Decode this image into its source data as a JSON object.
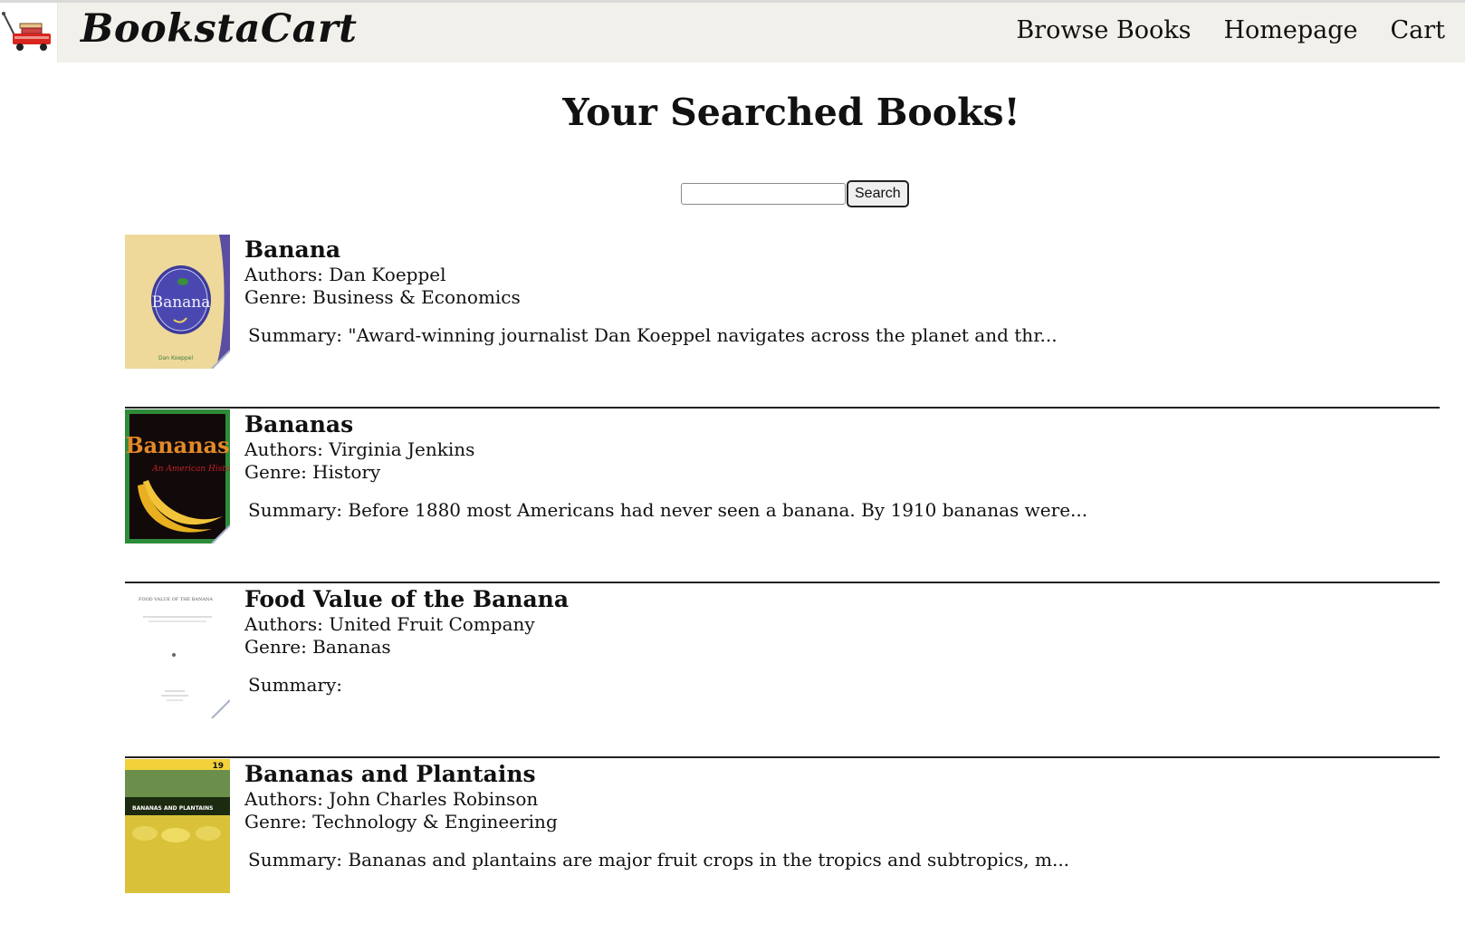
{
  "header": {
    "brand": "BookstaCart",
    "nav": [
      "Browse Books",
      "Homepage",
      "Cart"
    ]
  },
  "main": {
    "title": "Your Searched Books!",
    "search": {
      "value": "",
      "placeholder": "",
      "button_label": "Search"
    },
    "books": [
      {
        "title": "Banana",
        "authors": "Authors: Dan Koeppel",
        "genre": "Genre: Business & Economics",
        "summary": "Summary: \"Award-winning journalist Dan Koeppel navigates across the planet and thr..."
      },
      {
        "title": "Bananas",
        "authors": "Authors: Virginia Jenkins",
        "genre": "Genre: History",
        "summary": "Summary: Before 1880 most Americans had never seen a banana. By 1910 bananas were..."
      },
      {
        "title": "Food Value of the Banana",
        "authors": "Authors: United Fruit Company",
        "genre": "Genre: Bananas",
        "summary": "Summary:"
      },
      {
        "title": "Bananas and Plantains",
        "authors": "Authors: John Charles Robinson",
        "genre": "Genre: Technology & Engineering",
        "summary": "Summary: Bananas and plantains are major fruit crops in the tropics and subtropics, m..."
      }
    ]
  },
  "covers": {
    "banana_text": "Banana",
    "banana_author": "Dan Koeppel",
    "bananas_text": "Bananas",
    "bananas_sub": "An American History",
    "food_value_text": "FOOD VALUE OF THE BANANA",
    "plantains_text": "BANANAS AND PLANTAINS",
    "plantains_number": "19"
  },
  "colors": {
    "navbar_bg": "#f2f0ea",
    "rule": "#222222",
    "bananas_cover_border": "#2e8b3a"
  }
}
